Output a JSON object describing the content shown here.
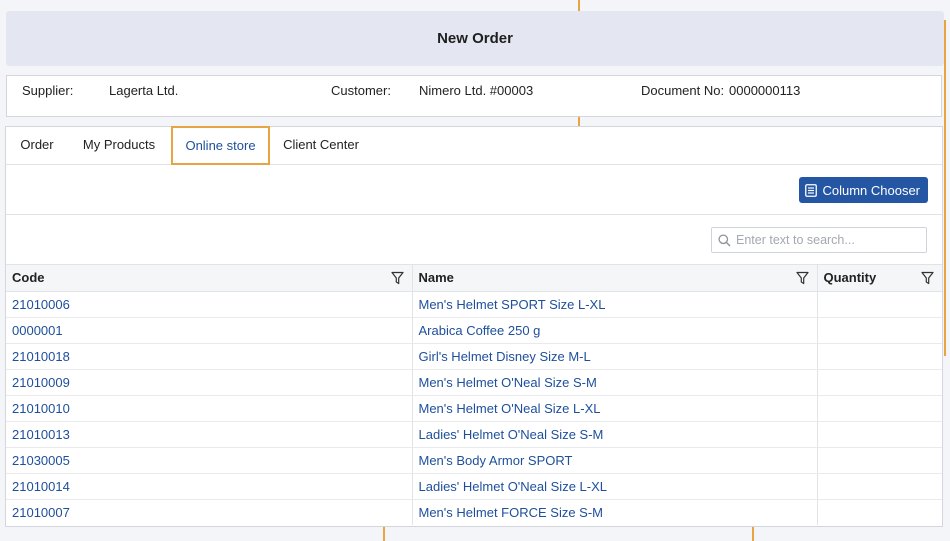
{
  "window": {
    "title": "New Order"
  },
  "header": {
    "supplier_label": "Supplier:",
    "supplier_value": "Lagerta Ltd.",
    "customer_label": "Customer:",
    "customer_value": "Nimero Ltd. #00003",
    "document_label": "Document No:",
    "document_value": "0000000113"
  },
  "tabs": [
    {
      "label": "Order",
      "active": false
    },
    {
      "label": "My Products",
      "active": false
    },
    {
      "label": "Online store",
      "active": true
    },
    {
      "label": "Client Center",
      "active": false
    }
  ],
  "toolbar": {
    "column_chooser_label": "Column Chooser",
    "icon": "column-chooser-icon"
  },
  "search": {
    "placeholder": "Enter text to search...",
    "value": ""
  },
  "table": {
    "columns": [
      "Code",
      "Name",
      "Quantity"
    ],
    "rows": [
      {
        "code": "21010006",
        "name": "Men's Helmet SPORT Size L-XL",
        "quantity": ""
      },
      {
        "code": "0000001",
        "name": "Arabica Coffee 250 g",
        "quantity": ""
      },
      {
        "code": "21010018",
        "name": "Girl's Helmet Disney Size M-L",
        "quantity": ""
      },
      {
        "code": "21010009",
        "name": "Men's Helmet O'Neal Size S-M",
        "quantity": ""
      },
      {
        "code": "21010010",
        "name": "Men's Helmet O'Neal Size L-XL",
        "quantity": ""
      },
      {
        "code": "21010013",
        "name": "Ladies' Helmet O'Neal Size S-M",
        "quantity": ""
      },
      {
        "code": "21030005",
        "name": "Men's Body Armor SPORT",
        "quantity": ""
      },
      {
        "code": "21010014",
        "name": "Ladies' Helmet O'Neal Size L-XL",
        "quantity": ""
      },
      {
        "code": "21010007",
        "name": "Men's Helmet FORCE Size S-M",
        "quantity": ""
      }
    ]
  },
  "colors": {
    "accent": "#e8a443",
    "link": "#1e4f9c",
    "button": "#2456a4"
  }
}
